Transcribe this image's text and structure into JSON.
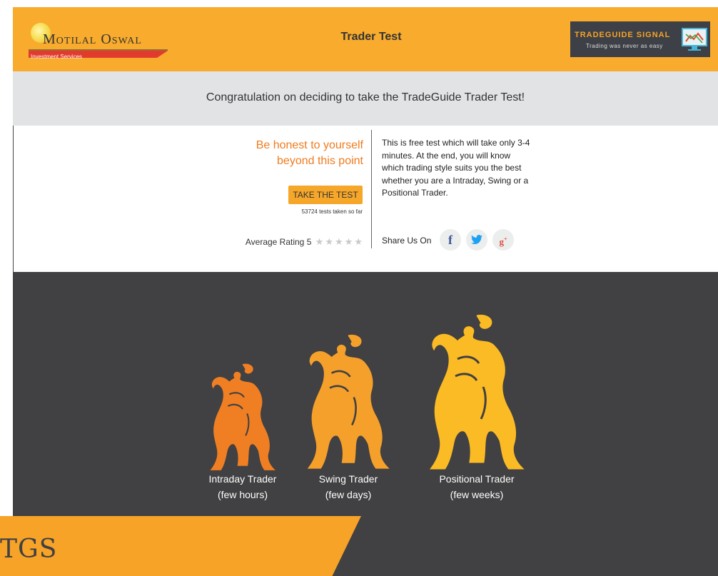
{
  "header": {
    "brand_name": "Motilal Oswal",
    "brand_tagline": "Investment Services",
    "title": "Trader Test",
    "badge_name": "TRADEGUIDE SIGNAL",
    "badge_tagline": "Trading was never as easy"
  },
  "banner": {
    "text": "Congratulation on deciding to take the TradeGuide Trader Test!"
  },
  "intro": {
    "heading": "Be honest to yourself beyond this point",
    "cta_label": "TAKE THE TEST",
    "tests_count": "53724 tests taken so far",
    "rating_label": "Average Rating 5",
    "rating_value": 5,
    "rating_max": 5,
    "description": "This is free test which will take only 3-4 minutes. At the end, you will know which trading style suits you the best whether you are a Intraday, Swing or a Positional Trader.",
    "share_label": "Share Us On"
  },
  "social": [
    {
      "name": "facebook-icon",
      "glyph": "f",
      "color": "#3b5998"
    },
    {
      "name": "twitter-icon",
      "glyph": "🐦",
      "color": "#1da1f2"
    },
    {
      "name": "google-plus-icon",
      "glyph": "g+",
      "color": "#dd4b39"
    }
  ],
  "traders": [
    {
      "type": "Intraday Trader",
      "duration": "(few hours)",
      "color": "#f07f24"
    },
    {
      "type": "Swing Trader",
      "duration": "(few days)",
      "color": "#f5a02a"
    },
    {
      "type": "Positional Trader",
      "duration": "(few weeks)",
      "color": "#fbbb24"
    }
  ],
  "footer": {
    "logo_text": "TGS"
  },
  "colors": {
    "accent": "#f8ab2d",
    "dark_panel": "#414042",
    "heading_orange": "#f07b1e"
  }
}
